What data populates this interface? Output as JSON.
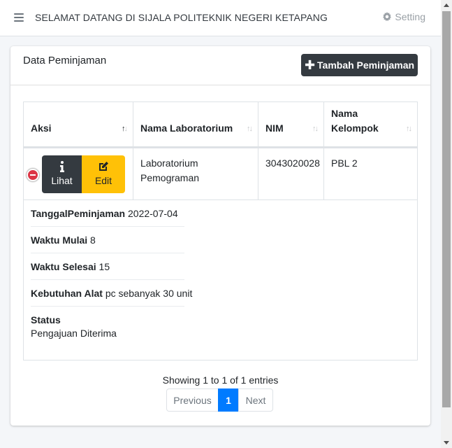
{
  "navbar": {
    "title": "SELAMAT DATANG DI SIJALA POLITEKNIK NEGERI KETAPANG",
    "setting_label": "Setting"
  },
  "card": {
    "title": "Data Peminjaman",
    "add_button_label": "Tambah Peminjaman"
  },
  "table": {
    "columns": [
      {
        "label": "Aksi"
      },
      {
        "label": "Nama Laboratorium"
      },
      {
        "label": "NIM"
      },
      {
        "label": "Nama Kelompok"
      }
    ],
    "rows": [
      {
        "lihat_label": "Lihat",
        "edit_label": "Edit",
        "nama_laboratorium": "Laboratorium Pemograman",
        "nim": "3043020028",
        "nama_kelompok": "PBL 2",
        "details": [
          {
            "label": "TanggalPeminjaman",
            "value": "2022-07-04"
          },
          {
            "label": "Waktu Mulai",
            "value": "8"
          },
          {
            "label": "Waktu Selesai",
            "value": "15"
          },
          {
            "label": "Kebutuhan Alat",
            "value": "pc sebanyak 30 unit"
          },
          {
            "label": "Status",
            "value": "Pengajuan Diterima"
          }
        ]
      }
    ]
  },
  "footer": {
    "info": "Showing 1 to 1 of 1 entries",
    "previous_label": "Previous",
    "current_page": "1",
    "next_label": "Next"
  },
  "colors": {
    "dark": "#343a40",
    "warning": "#ffc107",
    "primary": "#007bff",
    "danger": "#dc3545"
  }
}
